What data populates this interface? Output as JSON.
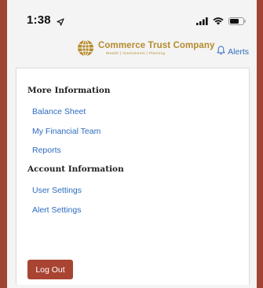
{
  "status_bar": {
    "time": "1:38"
  },
  "header": {
    "logo_name": "Commerce Trust Company",
    "logo_tagline": "Wealth  |  Investments  |  Planning",
    "alerts_label": "Alerts"
  },
  "menu": {
    "sections": [
      {
        "heading": "More Information",
        "items": [
          "Balance Sheet",
          "My Financial Team",
          "Reports"
        ]
      },
      {
        "heading": "Account Information",
        "items": [
          "User Settings",
          "Alert Settings"
        ]
      }
    ]
  },
  "footer": {
    "logout_label": "Log Out"
  },
  "colors": {
    "frame_border": "#a04433",
    "brand_gold": "#b58b2e",
    "link_blue": "#2d6bbf",
    "logout_button": "#a94432"
  },
  "icons": {
    "location": "location-arrow-icon",
    "signal": "cellular-signal-icon",
    "wifi": "wifi-icon",
    "battery": "battery-icon",
    "logo": "globe-logo-icon",
    "alerts": "bell-icon"
  }
}
